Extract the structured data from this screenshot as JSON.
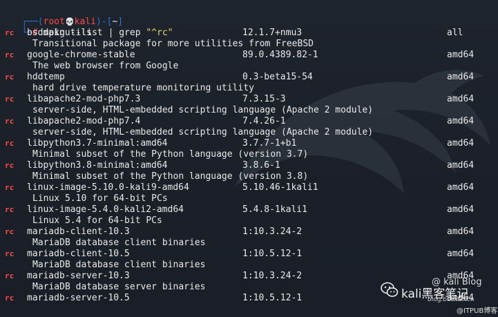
{
  "prompt": {
    "box_top_left": "┌──(",
    "user": "root",
    "skull": "💀",
    "host": "kali",
    "box_mid": ")-[",
    "cwd": "~",
    "box_end": "]",
    "box_bottom": "└─",
    "hash": "#",
    "command_dpkg": "dpkg",
    "command_opt": "--list",
    "command_pipe": "|",
    "command_grep": "grep",
    "command_pattern": "\"^rc\""
  },
  "packages": [
    {
      "status": "rc",
      "name": "bsdmainutils",
      "version": "12.1.7+nmu3",
      "arch": "all",
      "description": "Transitional package for more utilities from FreeBSD"
    },
    {
      "status": "rc",
      "name": "google-chrome-stable",
      "version": "89.0.4389.82-1",
      "arch": "amd64",
      "description": "The web browser from Google"
    },
    {
      "status": "rc",
      "name": "hddtemp",
      "version": "0.3-beta15-54",
      "arch": "amd64",
      "description": "hard drive temperature monitoring utility"
    },
    {
      "status": "rc",
      "name": "libapache2-mod-php7.3",
      "version": "7.3.15-3",
      "arch": "amd64",
      "description": "server-side, HTML-embedded scripting language (Apache 2 module)"
    },
    {
      "status": "rc",
      "name": "libapache2-mod-php7.4",
      "version": "7.4.26-1",
      "arch": "amd64",
      "description": "server-side, HTML-embedded scripting language (Apache 2 module)"
    },
    {
      "status": "rc",
      "name": "libpython3.7-minimal:amd64",
      "version": "3.7.7-1+b1",
      "arch": "amd64",
      "description": "Minimal subset of the Python language (version 3.7)"
    },
    {
      "status": "rc",
      "name": "libpython3.8-minimal:amd64",
      "version": "3.8.6-1",
      "arch": "amd64",
      "description": "Minimal subset of the Python language (version 3.8)"
    },
    {
      "status": "rc",
      "name": "linux-image-5.10.0-kali9-amd64",
      "version": "5.10.46-1kali1",
      "arch": "amd64",
      "description": "Linux 5.10 for 64-bit PCs"
    },
    {
      "status": "rc",
      "name": "linux-image-5.4.0-kali2-amd64",
      "version": "5.4.8-1kali1",
      "arch": "amd64",
      "description": "Linux 5.4 for 64-bit PCs"
    },
    {
      "status": "rc",
      "name": "mariadb-client-10.3",
      "version": "1:10.3.24-2",
      "arch": "amd64",
      "description": "MariaDB database client binaries"
    },
    {
      "status": "rc",
      "name": "mariadb-client-10.5",
      "version": "1:10.5.12-1",
      "arch": "amd64",
      "description": "MariaDB database client binaries"
    },
    {
      "status": "rc",
      "name": "mariadb-server-10.3",
      "version": "1:10.3.24-2",
      "arch": "amd64",
      "description": "MariaDB database server binaries"
    },
    {
      "status": "rc",
      "name": "mariadb-server-10.5",
      "version": "1:10.5.12-1",
      "arch": "amd64",
      "description": ""
    }
  ],
  "watermark": {
    "name": "kali黑客笔记",
    "handle": "@ kali Blog",
    "url": "blog.bbskali.cn",
    "site": "@ITPUB博客"
  },
  "colors": {
    "background": "#1c2129",
    "prompt_box": "#2f6fde",
    "prompt_user": "#ff4a4a",
    "status_rc": "#ff4a4a",
    "text": "#e9e9e9"
  }
}
